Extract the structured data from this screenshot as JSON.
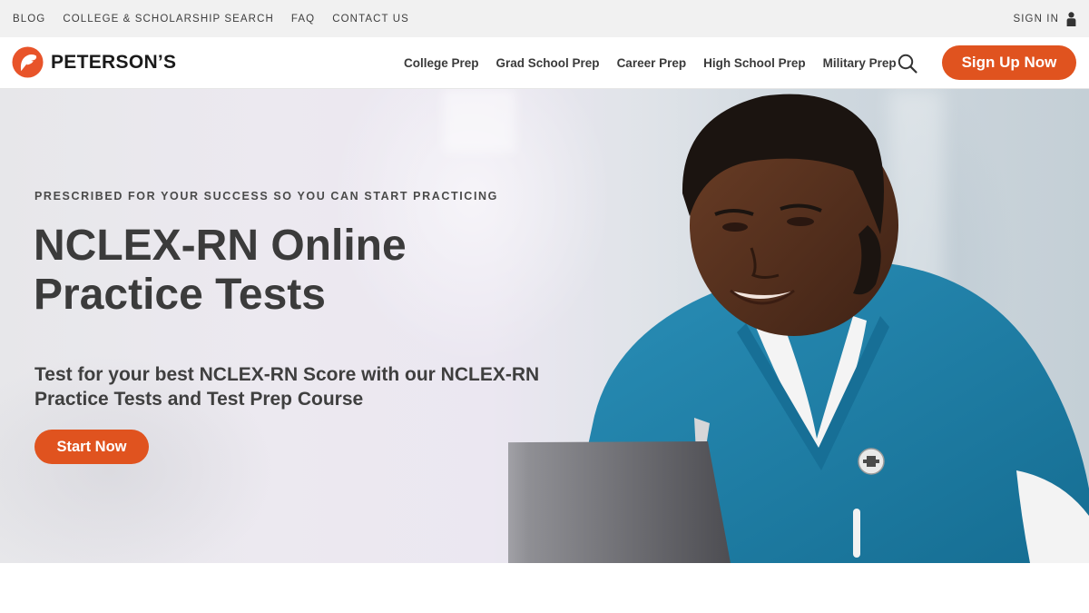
{
  "utility_nav": {
    "links": [
      "BLOG",
      "COLLEGE & SCHOLARSHIP SEARCH",
      "FAQ",
      "CONTACT US"
    ],
    "sign_in": "SIGN IN"
  },
  "header": {
    "logo_text": "PETERSON’S",
    "nav": [
      "College Prep",
      "Grad School Prep",
      "Career Prep",
      "High School Prep",
      "Military Prep"
    ],
    "signup_label": "Sign Up Now"
  },
  "hero": {
    "eyebrow": "PRESCRIBED FOR YOUR SUCCESS SO YOU CAN START PRACTICING",
    "title": "NCLEX-RN Online Practice Tests",
    "subtitle": "Test for your best NCLEX-RN Score with our NCLEX-RN Practice Tests and Test Prep Course",
    "cta_label": "Start Now"
  },
  "colors": {
    "accent": "#e0531f",
    "utility_bar_bg": "#f1f1f1",
    "heading_text": "#3b3b3b",
    "scrubs": "#1f7fa8"
  },
  "icons": [
    "user-icon",
    "search-icon",
    "petersons-logo-icon"
  ]
}
